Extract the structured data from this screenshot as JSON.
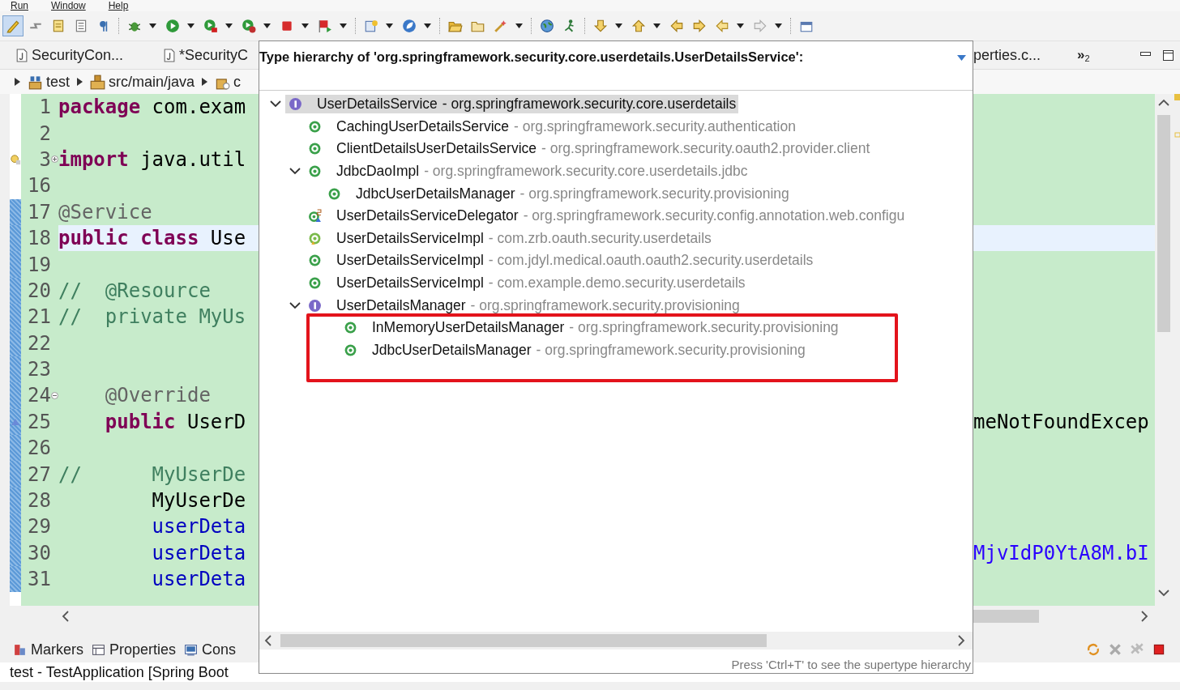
{
  "menu": [
    {
      "label": "Run"
    },
    {
      "label": "Window"
    },
    {
      "label": "Help"
    }
  ],
  "toolbar": [
    {
      "kind": "pencil",
      "pressed": true,
      "dropdown": false
    },
    {
      "kind": "arrows",
      "pressed": false,
      "dropdown": false
    },
    {
      "kind": "note",
      "pressed": false,
      "dropdown": false
    },
    {
      "kind": "page",
      "pressed": false,
      "dropdown": false
    },
    {
      "kind": "paragraph",
      "pressed": false,
      "dropdown": false
    },
    {
      "kind": "separator"
    },
    {
      "kind": "bug",
      "pressed": false,
      "dropdown": true
    },
    {
      "kind": "run",
      "pressed": false,
      "dropdown": true
    },
    {
      "kind": "run-coverage",
      "pressed": false,
      "dropdown": true
    },
    {
      "kind": "run-tool",
      "pressed": false,
      "dropdown": true
    },
    {
      "kind": "stop",
      "pressed": false,
      "dropdown": true
    },
    {
      "kind": "flag",
      "pressed": false,
      "dropdown": true
    },
    {
      "kind": "separator"
    },
    {
      "kind": "wizard",
      "pressed": false,
      "dropdown": true
    },
    {
      "kind": "leaf",
      "pressed": false,
      "dropdown": true
    },
    {
      "kind": "separator"
    },
    {
      "kind": "folder-open",
      "pressed": false,
      "dropdown": false
    },
    {
      "kind": "folder",
      "pressed": false,
      "dropdown": false
    },
    {
      "kind": "wand",
      "pressed": false,
      "dropdown": true
    },
    {
      "kind": "separator"
    },
    {
      "kind": "globe",
      "pressed": false,
      "dropdown": false
    },
    {
      "kind": "runner",
      "pressed": false,
      "dropdown": false
    },
    {
      "kind": "separator"
    },
    {
      "kind": "down-arrow",
      "pressed": false,
      "dropdown": true
    },
    {
      "kind": "up-arrow",
      "pressed": false,
      "dropdown": true
    },
    {
      "kind": "edit-back",
      "pressed": false,
      "dropdown": false
    },
    {
      "kind": "edit-forward",
      "pressed": false,
      "dropdown": false
    },
    {
      "kind": "back",
      "pressed": false,
      "dropdown": true
    },
    {
      "kind": "forward-disabled",
      "pressed": false,
      "dropdown": true
    },
    {
      "kind": "separator"
    },
    {
      "kind": "window",
      "pressed": false,
      "dropdown": false
    }
  ],
  "editor_tabs": [
    {
      "label": "SecurityCon...",
      "kind": "java"
    },
    {
      "label": "*SecurityC",
      "kind": "java"
    },
    {
      "label": "perties.c...",
      "kind": "none"
    }
  ],
  "overflow_tabs": {
    "label": "»",
    "count": "2"
  },
  "breadcrumb": [
    {
      "label": "test",
      "kind": "project"
    },
    {
      "label": "src/main/java",
      "kind": "source-folder"
    },
    {
      "label": "c",
      "kind": "package"
    }
  ],
  "editor": {
    "lines": [
      {
        "number": "1",
        "kind": "code",
        "current": false,
        "changed": false,
        "segments": [
          {
            "text": "package",
            "kind": "keyword"
          },
          {
            "text": " com.exam",
            "kind": "plain"
          }
        ]
      },
      {
        "number": "2",
        "kind": "code",
        "current": false,
        "changed": false
      },
      {
        "number": "3",
        "kind": "folded-import",
        "current": false,
        "changed": false,
        "segments": [
          {
            "text": "import",
            "kind": "keyword"
          },
          {
            "text": " java.util",
            "kind": "plain"
          }
        ]
      },
      {
        "number": "16",
        "kind": "code",
        "current": false,
        "changed": false
      },
      {
        "number": "17",
        "kind": "code",
        "current": false,
        "changed": true,
        "segments": [
          {
            "text": "@Service",
            "kind": "annotation"
          }
        ]
      },
      {
        "number": "18",
        "kind": "code",
        "current": true,
        "changed": true,
        "segments": [
          {
            "text": "public class",
            "kind": "keyword"
          },
          {
            "text": " Use",
            "kind": "plain"
          }
        ]
      },
      {
        "number": "19",
        "kind": "code",
        "current": false,
        "changed": true
      },
      {
        "number": "20",
        "kind": "code",
        "current": false,
        "changed": true,
        "segments": [
          {
            "text": "//  @Resource",
            "kind": "comment"
          }
        ]
      },
      {
        "number": "21",
        "kind": "code",
        "current": false,
        "changed": true,
        "segments": [
          {
            "text": "//  private MyUs",
            "kind": "comment"
          }
        ]
      },
      {
        "number": "22",
        "kind": "code",
        "current": false,
        "changed": true
      },
      {
        "number": "23",
        "kind": "code",
        "current": false,
        "changed": true
      },
      {
        "number": "24",
        "kind": "method-start",
        "current": false,
        "changed": true,
        "segments": [
          {
            "text": "    @Override",
            "kind": "annotation"
          }
        ]
      },
      {
        "number": "25",
        "kind": "override",
        "current": false,
        "changed": true,
        "segments": [
          {
            "text": "    public",
            "kind": "keyword"
          },
          {
            "text": " UserD",
            "kind": "plain"
          }
        ],
        "right": [
          {
            "text": "meNotFoundExcep",
            "kind": "plain"
          }
        ]
      },
      {
        "number": "26",
        "kind": "code",
        "current": false,
        "changed": true
      },
      {
        "number": "27",
        "kind": "code",
        "current": false,
        "changed": true,
        "segments": [
          {
            "text": "//      MyUserDe",
            "kind": "comment"
          }
        ]
      },
      {
        "number": "28",
        "kind": "code",
        "current": false,
        "changed": true,
        "segments": [
          {
            "text": "        MyUserDe",
            "kind": "plain"
          }
        ]
      },
      {
        "number": "29",
        "kind": "code",
        "current": false,
        "changed": true,
        "segments": [
          {
            "text": "        userDeta",
            "kind": "field"
          }
        ]
      },
      {
        "number": "30",
        "kind": "code",
        "current": false,
        "changed": true,
        "segments": [
          {
            "text": "        userDeta",
            "kind": "field"
          }
        ],
        "right": [
          {
            "text": "MjvIdP0YtA8M.bI",
            "kind": "string"
          }
        ]
      },
      {
        "number": "31",
        "kind": "code",
        "current": false,
        "changed": true,
        "segments": [
          {
            "text": "        userDeta",
            "kind": "field"
          }
        ]
      }
    ]
  },
  "hierarchy_popup": {
    "title": "Type hierarchy of 'org.springframework.security.core.userdetails.UserDetailsService':",
    "tree": [
      {
        "name": "UserDetailsService",
        "package": "- org.springframework.security.core.userdetails",
        "kind": "interface",
        "selected": true,
        "expanded": true,
        "children": [
          {
            "name": "CachingUserDetailsService",
            "package": "- org.springframework.security.authentication",
            "kind": "class",
            "selected": false
          },
          {
            "name": "ClientDetailsUserDetailsService",
            "package": "- org.springframework.security.oauth2.provider.client",
            "kind": "class",
            "selected": false
          },
          {
            "name": "JdbcDaoImpl",
            "package": "- org.springframework.security.core.userdetails.jdbc",
            "kind": "class",
            "selected": false,
            "expanded": true,
            "children": [
              {
                "name": "JdbcUserDetailsManager",
                "package": "- org.springframework.security.provisioning",
                "kind": "class",
                "selected": false
              }
            ]
          },
          {
            "name": "UserDetailsServiceDelegator",
            "package": "- org.springframework.security.config.annotation.web.configu",
            "kind": "static-class",
            "selected": false
          },
          {
            "name": "UserDetailsServiceImpl",
            "package": "- com.zrb.oauth.security.userdetails",
            "kind": "class-warning",
            "selected": false
          },
          {
            "name": "UserDetailsServiceImpl",
            "package": "- com.jdyl.medical.oauth.oauth2.security.userdetails",
            "kind": "class",
            "selected": false
          },
          {
            "name": "UserDetailsServiceImpl",
            "package": "- com.example.demo.security.userdetails",
            "kind": "class",
            "selected": false
          },
          {
            "name": "UserDetailsManager",
            "package": "- org.springframework.security.provisioning",
            "kind": "interface",
            "selected": false,
            "expanded": true,
            "boxed_children": true,
            "children": [
              {
                "name": "InMemoryUserDetailsManager",
                "package": "- org.springframework.security.provisioning",
                "kind": "class",
                "selected": false
              },
              {
                "name": "JdbcUserDetailsManager",
                "package": "- org.springframework.security.provisioning",
                "kind": "class",
                "selected": false
              }
            ]
          }
        ]
      }
    ],
    "status": "Press 'Ctrl+T' to see the supertype hierarchy"
  },
  "bottom_panel": {
    "tabs": [
      {
        "label": "Markers",
        "kind": "markers"
      },
      {
        "label": "Properties",
        "kind": "properties"
      },
      {
        "label": "Cons",
        "kind": "console"
      }
    ],
    "console_title": "test - TestApplication [Spring Boot"
  }
}
